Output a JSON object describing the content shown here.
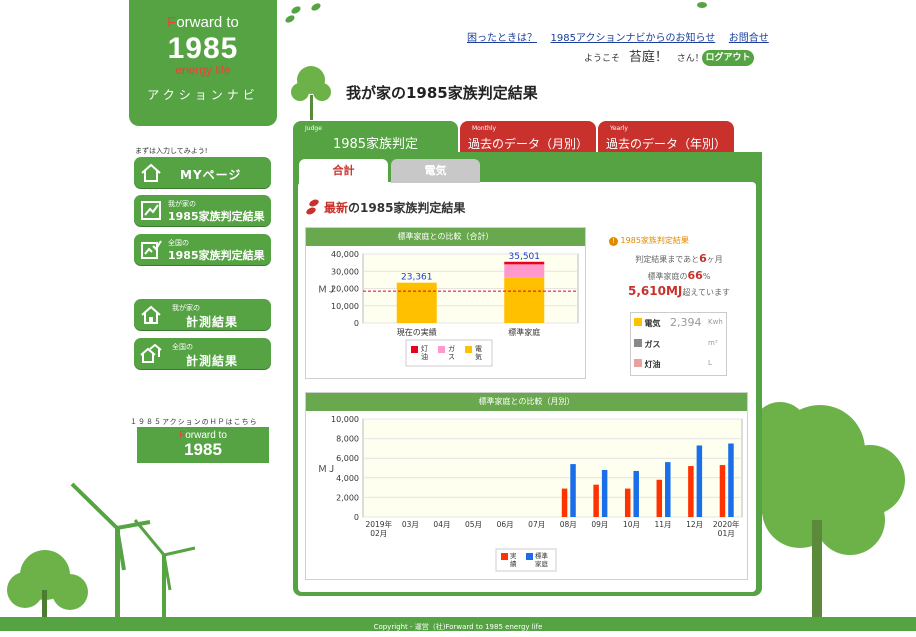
{
  "brand": {
    "logo_line1_f": "F",
    "logo_line1_rest": "orward to",
    "logo_line2": "1985",
    "logo_line3": "energy life",
    "logo_line4": "アクションナビ",
    "banner_caption": "１９８５アクションのＨＰはこちら",
    "banner_line1_f": "F",
    "banner_line1_rest": "orward to",
    "banner_line2": "1985"
  },
  "header": {
    "links": [
      "困ったときは？",
      "1985アクションナビからのお知らせ",
      "お問合せ"
    ],
    "welcome_prefix": "ようこそ",
    "user_name": "苔庭！",
    "welcome_suffix": "さん！",
    "logout_label": "ログアウト",
    "page_title": "我が家の1985家族判定結果"
  },
  "sidebar": {
    "hint": "まずは入力してみよう!",
    "items": [
      {
        "small": "",
        "label": "MYページ"
      },
      {
        "small": "我が家の",
        "label": "1985家族判定結果"
      },
      {
        "small": "全国の",
        "label": "1985家族判定結果"
      },
      {
        "small": "我が家の",
        "label": "計測結果"
      },
      {
        "small": "全国の",
        "label": "計測結果"
      }
    ]
  },
  "tabs": [
    {
      "en": "Judge",
      "label": "1985家族判定",
      "active": true
    },
    {
      "en": "Monthly",
      "label": "過去のデータ（月別）",
      "active": false
    },
    {
      "en": "Yearly",
      "label": "過去のデータ（年別）",
      "active": false
    }
  ],
  "subtabs": [
    "合計",
    "電気"
  ],
  "section": {
    "title_highlight": "最新",
    "title_rest": "の1985家族判定結果"
  },
  "summary": {
    "heading": "1985家族判定結果",
    "line1_prefix": "判定結果まであと",
    "line1_value": "6",
    "line1_unit": "ヶ月",
    "line2_prefix": "標準家庭の",
    "line2_value": "66",
    "line2_unit": "%",
    "line3_value": "5,610MJ",
    "line3_suffix": "超えています",
    "meters": [
      {
        "label": "電気",
        "value": "2,394",
        "unit": "Kwh"
      },
      {
        "label": "ガス",
        "value": "",
        "unit": "m³"
      },
      {
        "label": "灯油",
        "value": "",
        "unit": "L"
      }
    ]
  },
  "colors": {
    "green": "#55a343",
    "red_tab": "#c8312c",
    "electric": "#ffc000",
    "gas": "#ff99cc",
    "kerosene": "#e8001c",
    "actual": "#ff3300",
    "standard": "#1a6fe8"
  },
  "chart_data": [
    {
      "type": "bar",
      "title": "標準家庭との比較（合計）",
      "ylabel": "ＭＪ",
      "ylim": [
        0,
        40000
      ],
      "yticks": [
        "40,000",
        "30,000",
        "20,000",
        "10,000",
        "0"
      ],
      "categories": [
        "現在の実績",
        "標準家庭"
      ],
      "series": [
        {
          "name": "灯油",
          "values": [
            0,
            1500
          ]
        },
        {
          "name": "ガス",
          "values": [
            0,
            7800
          ]
        },
        {
          "name": "電気",
          "values": [
            23361,
            26201
          ]
        }
      ],
      "totals": [
        "23,361",
        "35,501"
      ],
      "reference_line": 18500,
      "legend": [
        "灯油",
        "ガス",
        "電気"
      ]
    },
    {
      "type": "bar",
      "title": "標準家庭との比較（月別）",
      "ylabel": "ＭＪ",
      "ylim": [
        0,
        10000
      ],
      "yticks": [
        "10,000",
        "8,000",
        "6,000",
        "4,000",
        "2,000",
        "0"
      ],
      "categories": [
        "2019年 02月",
        "03月",
        "04月",
        "05月",
        "06月",
        "07月",
        "08月",
        "09月",
        "10月",
        "11月",
        "12月",
        "2020年 01月"
      ],
      "series": [
        {
          "name": "実績",
          "values": [
            0,
            0,
            0,
            0,
            0,
            0,
            2900,
            3300,
            2900,
            3800,
            5200,
            5300
          ]
        },
        {
          "name": "標準家庭",
          "values": [
            0,
            0,
            0,
            0,
            0,
            0,
            5400,
            4800,
            4700,
            5600,
            7300,
            7500
          ]
        }
      ],
      "legend": [
        "実績",
        "標準家庭"
      ]
    }
  ],
  "footer": {
    "text": "Copyright - 運営（社)Forward to 1985 energy life"
  }
}
